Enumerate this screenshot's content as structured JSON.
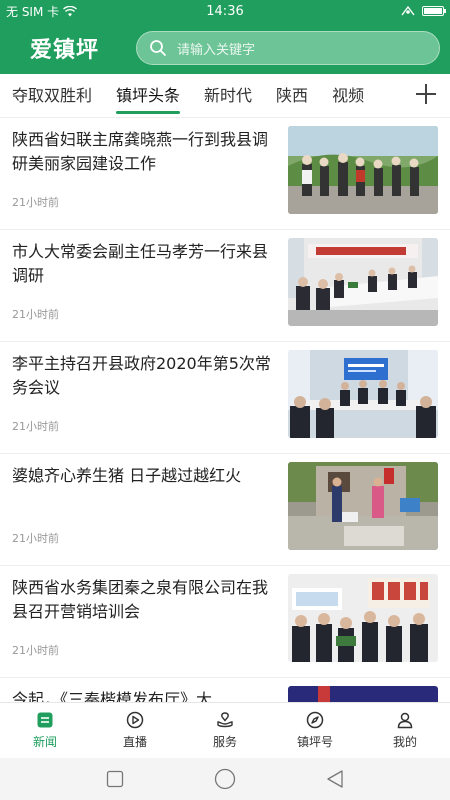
{
  "status_bar": {
    "carrier": "无 SIM 卡",
    "time": "14:36"
  },
  "header": {
    "logo": "爱镇坪",
    "search_placeholder": "请输入关键字"
  },
  "tabs": [
    {
      "label": "夺取双胜利"
    },
    {
      "label": "镇坪头条"
    },
    {
      "label": "新时代"
    },
    {
      "label": "陕西"
    },
    {
      "label": "视频"
    }
  ],
  "active_tab": "镇坪头条",
  "add_tab_icon": "plus-icon",
  "news": [
    {
      "title": "陕西省妇联主席龚晓燕一行到我县调研美丽家园建设工作",
      "time": "21小时前"
    },
    {
      "title": "市人大常委会副主任马孝芳一行来县调研",
      "time": "21小时前"
    },
    {
      "title": "李平主持召开县政府2020年第5次常务会议",
      "time": "21小时前"
    },
    {
      "title": "婆媳齐心养生猪 日子越过越红火",
      "time": "21小时前"
    },
    {
      "title": "陕西省水务集团秦之泉有限公司在我县召开营销培训会",
      "time": "21小时前"
    },
    {
      "title": "今起，《三秦楷模发布厅》大",
      "time": ""
    }
  ],
  "bottom_nav": [
    {
      "label": "新闻",
      "icon": "news-icon"
    },
    {
      "label": "直播",
      "icon": "live-icon"
    },
    {
      "label": "服务",
      "icon": "service-icon"
    },
    {
      "label": "镇坪号",
      "icon": "compass-icon"
    },
    {
      "label": "我的",
      "icon": "user-icon"
    }
  ],
  "colors": {
    "brand": "#1f9e5d",
    "text": "#222222",
    "muted": "#999999"
  }
}
